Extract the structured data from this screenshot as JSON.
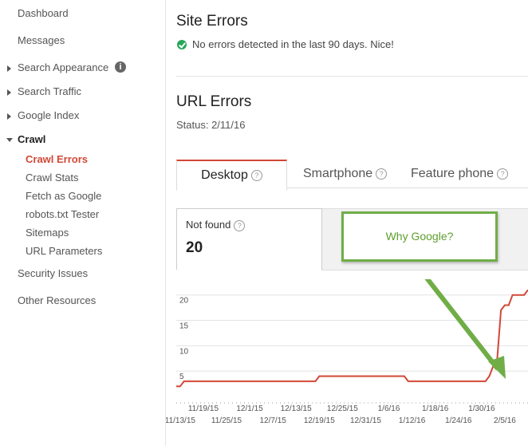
{
  "sidebar": {
    "dashboard": "Dashboard",
    "messages": "Messages",
    "search_appearance": "Search Appearance",
    "search_traffic": "Search Traffic",
    "google_index": "Google Index",
    "crawl": "Crawl",
    "crawl_items": [
      "Crawl Errors",
      "Crawl Stats",
      "Fetch as Google",
      "robots.txt Tester",
      "Sitemaps",
      "URL Parameters"
    ],
    "security_issues": "Security Issues",
    "other_resources": "Other Resources",
    "info_icon_glyph": "i"
  },
  "site_errors": {
    "title": "Site Errors",
    "message": "No errors detected in the last 90 days. Nice!"
  },
  "url_errors": {
    "title": "URL Errors",
    "status": "Status: 2/11/16",
    "tabs": [
      "Desktop",
      "Smartphone",
      "Feature phone"
    ],
    "active_tab": "Desktop",
    "help_glyph": "?",
    "metric_label": "Not found",
    "metric_value": "20"
  },
  "callout": {
    "text": "Why Google?",
    "color": "#70ad47"
  },
  "colors": {
    "accent": "#d14836",
    "success": "#26a65b"
  },
  "chart_data": {
    "type": "line",
    "y_ticks": [
      "20",
      "15",
      "10",
      "5"
    ],
    "ylim": [
      0,
      22
    ],
    "x_ticks_top": [
      "11/19/15",
      "12/1/15",
      "12/13/15",
      "12/25/15",
      "1/6/16",
      "1/18/16",
      "1/30/16"
    ],
    "x_ticks_bottom": [
      "11/13/15",
      "11/25/15",
      "12/7/15",
      "12/19/15",
      "12/31/15",
      "1/12/16",
      "1/24/16",
      "2/5/16"
    ],
    "series": [
      {
        "color": "#d14836",
        "x": [
          "11/12/15",
          "11/13/15",
          "11/14/15",
          "12/18/15",
          "12/19/15",
          "1/10/16",
          "1/11/16",
          "1/31/16",
          "2/1/16",
          "2/2/16",
          "2/3/16",
          "2/4/16",
          "2/5/16",
          "2/6/16",
          "2/7/16",
          "2/8/16",
          "2/9/16",
          "2/10/16",
          "2/11/16"
        ],
        "values": [
          2,
          2,
          3,
          3,
          4,
          4,
          3,
          3,
          4,
          6,
          7,
          17,
          18,
          18,
          20,
          20,
          20,
          20,
          21
        ]
      }
    ]
  }
}
